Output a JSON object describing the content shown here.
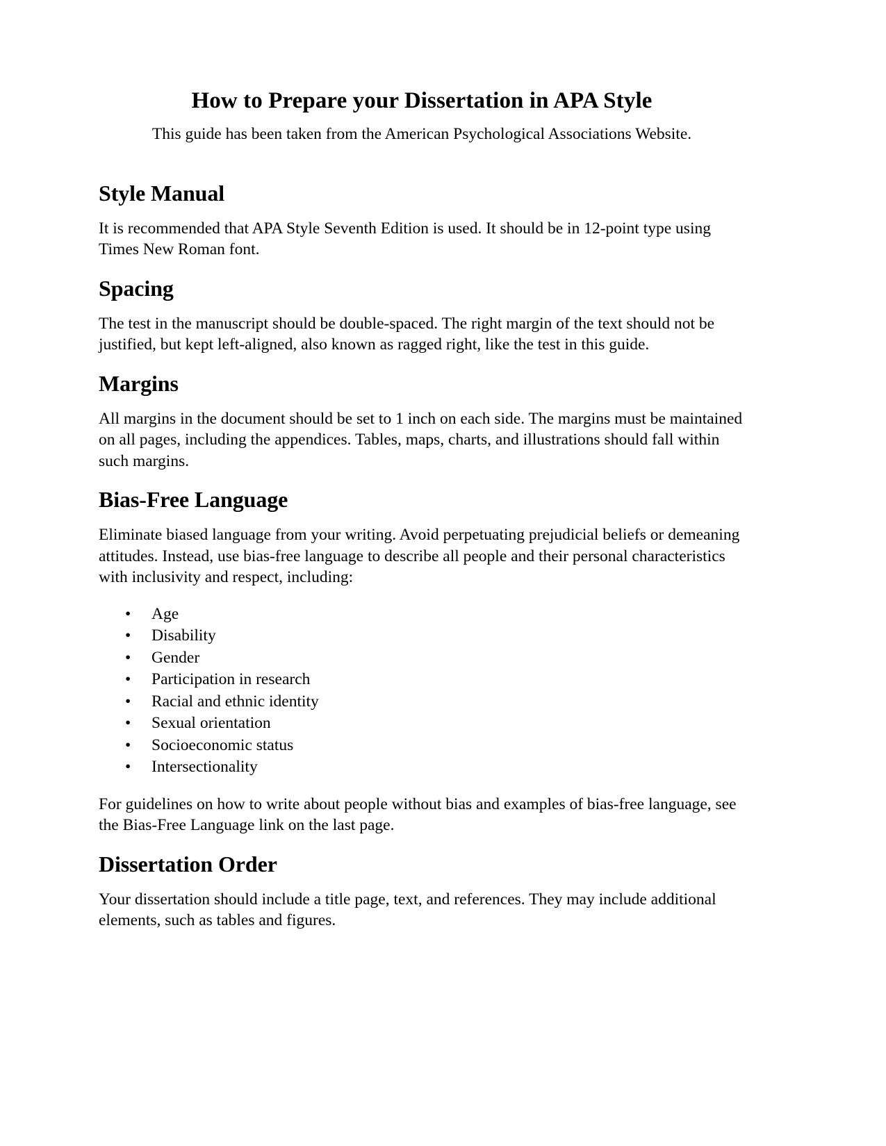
{
  "document": {
    "title": "How to Prepare your Dissertation in APA Style",
    "subtitle": "This guide has been taken from the American Psychological Associations Website.",
    "sections": [
      {
        "heading": "Style Manual",
        "paragraphs": [
          "It is recommended that APA Style Seventh Edition is used. It should be in 12-point type using Times New Roman font."
        ]
      },
      {
        "heading": "Spacing",
        "paragraphs": [
          "The test in the manuscript should be double-spaced. The right margin of the text should not be justified, but kept left-aligned, also known as ragged right, like the test in this guide."
        ]
      },
      {
        "heading": "Margins",
        "paragraphs": [
          "All margins in the document should be set to 1 inch on each side. The margins must be maintained on all pages, including the appendices. Tables, maps, charts, and illustrations should fall within such margins."
        ]
      },
      {
        "heading": "Bias-Free Language",
        "intro": "Eliminate biased language from your writing. Avoid perpetuating prejudicial beliefs or demeaning attitudes. Instead, use bias-free language to describe all people and their personal characteristics with inclusivity and respect, including:",
        "list_bullet": "•",
        "list": [
          "Age",
          "Disability",
          "Gender",
          "Participation in research",
          "Racial and ethnic identity",
          "Sexual orientation",
          "Socioeconomic status",
          "Intersectionality"
        ],
        "outro": "For guidelines on how to write about people without bias and examples of bias-free language, see the Bias-Free Language link on the last page."
      },
      {
        "heading": "Dissertation Order",
        "paragraphs": [
          "Your dissertation should include a title page, text, and references. They may include additional elements, such as tables and figures."
        ]
      }
    ]
  }
}
